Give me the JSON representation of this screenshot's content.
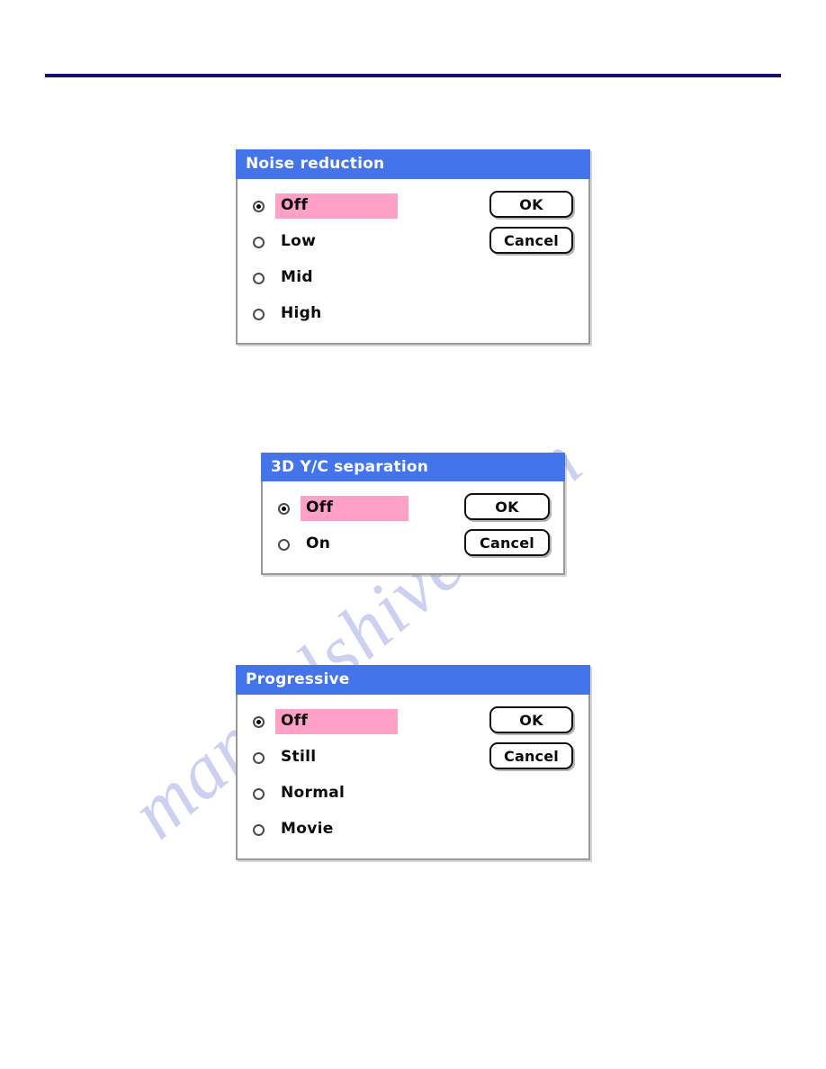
{
  "page": {
    "background": "#ffffff",
    "rule_color": "#101075",
    "watermark_text": "manualshive.com",
    "watermark_color": "#c3c8ee"
  },
  "theme": {
    "titlebar_blue": "#4374ea",
    "highlight_pink": "#ffa0c6",
    "dialog_border": "#9a9a9a",
    "button_border": "#111111",
    "title_text": "#ffffff",
    "label_text": "#0a0a0a"
  },
  "dialogs": [
    {
      "id": "noise-reduction",
      "title": "Noise reduction",
      "options": [
        {
          "label": "Off",
          "selected": true
        },
        {
          "label": "Low",
          "selected": false
        },
        {
          "label": "Mid",
          "selected": false
        },
        {
          "label": "High",
          "selected": false
        }
      ],
      "buttons": [
        {
          "label": "OK"
        },
        {
          "label": "Cancel"
        }
      ]
    },
    {
      "id": "3d-yc-separation",
      "title": "3D Y/C separation",
      "options": [
        {
          "label": "Off",
          "selected": true
        },
        {
          "label": "On",
          "selected": false
        }
      ],
      "buttons": [
        {
          "label": "OK"
        },
        {
          "label": "Cancel"
        }
      ]
    },
    {
      "id": "progressive",
      "title": "Progressive",
      "options": [
        {
          "label": "Off",
          "selected": true
        },
        {
          "label": "Still",
          "selected": false
        },
        {
          "label": "Normal",
          "selected": false
        },
        {
          "label": "Movie",
          "selected": false
        }
      ],
      "buttons": [
        {
          "label": "OK"
        },
        {
          "label": "Cancel"
        }
      ]
    }
  ]
}
